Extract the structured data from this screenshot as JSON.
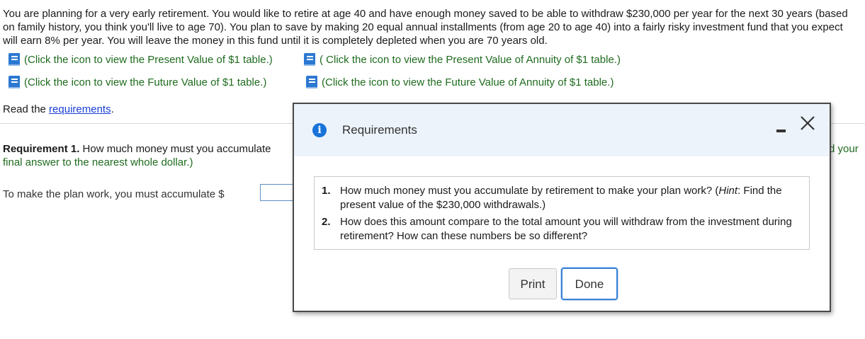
{
  "problem": {
    "text": "You are planning for a very early retirement. You would like to retire at age 40 and have enough money saved to be able to withdraw $230,000 per year for the next 30 years (based on family history, you think you'll live to age 70). You plan to save by making 20 equal annual installments (from age 20 to age 40) into a fairly risky investment fund that you expect will earn 8% per year. You will leave the money in this fund until it is completely depleted when you are 70 years old."
  },
  "table_links": [
    {
      "label": "(Click the icon to view the Present Value of $1 table.)",
      "icon": "book-icon"
    },
    {
      "label": "( Click the icon to view the Present Value of Annuity of $1 table.)",
      "icon": "book-icon"
    },
    {
      "label": "(Click the icon to view the Future Value of $1 table.)",
      "icon": "book-icon"
    },
    {
      "label": "(Click the icon to view the Future Value of Annuity of $1 table.)",
      "icon": "book-icon"
    }
  ],
  "read": {
    "prefix": "Read the ",
    "link": "requirements",
    "suffix": "."
  },
  "requirement1": {
    "bold": "Requirement 1.",
    "text": " How much money must you accumulate",
    "line2": "final answer to the nearest whole dollar.)",
    "right_fragment": "d your"
  },
  "accumulate": {
    "label": "To make the plan work, you must accumulate $",
    "value": ""
  },
  "modal": {
    "title": "Requirements",
    "items": [
      {
        "num": "1.",
        "pre": "How much money must you accumulate by retirement to make your plan work? (",
        "hint": "Hint",
        "post": ": Find the present value of the $230,000 withdrawals.)"
      },
      {
        "num": "2.",
        "text": "How does this amount compare to the total amount you will withdraw from the investment during retirement? How can these numbers be so different?"
      }
    ],
    "print_label": "Print",
    "done_label": "Done"
  },
  "colors": {
    "link_green": "#1e6b1e",
    "link_blue": "#1a3fd6",
    "icon_blue": "#1a73d9",
    "focus_blue": "#3b82d6"
  }
}
